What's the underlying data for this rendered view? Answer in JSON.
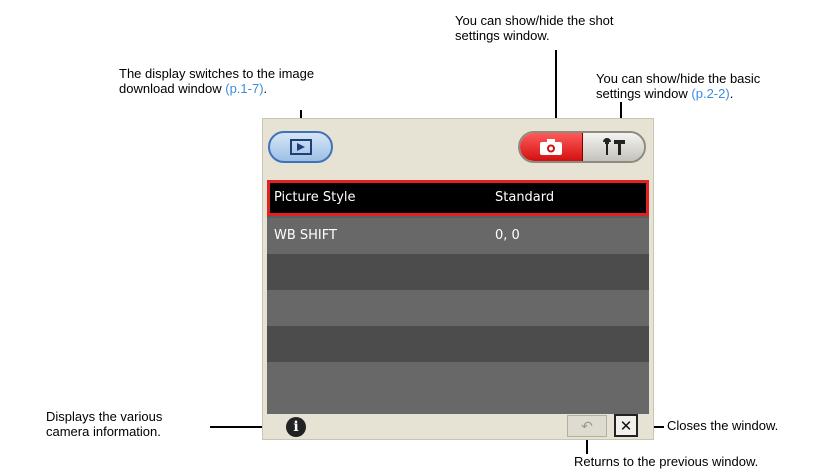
{
  "callouts": {
    "download": {
      "text": "The display switches to the image download window",
      "ref": "(p.1-7)",
      "end": "."
    },
    "shot": {
      "line1": "You can show/hide the shot",
      "line2": "settings window."
    },
    "basic": {
      "line1": "You can show/hide the basic",
      "line2": "settings window",
      "ref": "(p.2-2)",
      "end": "."
    },
    "info": {
      "line1": "Displays the various",
      "line2": "camera information."
    },
    "close": "Closes the window.",
    "back": "Returns to the previous window."
  },
  "window": {
    "rows": [
      {
        "label": "Picture Style",
        "value": "Standard",
        "selected": true
      },
      {
        "label": "WB SHIFT",
        "value": "0, 0"
      },
      {
        "label": "",
        "value": ""
      },
      {
        "label": "",
        "value": ""
      },
      {
        "label": "",
        "value": ""
      },
      {
        "label": "",
        "value": ""
      }
    ],
    "info_glyph": "i",
    "basic_glyph": "⚒",
    "close_glyph": "✕",
    "back_glyph": "↶"
  },
  "icons": {
    "download": "image-download-icon",
    "shot": "camera-icon",
    "basic": "tools-icon",
    "info": "info-icon",
    "back": "back-icon",
    "close": "close-icon"
  },
  "colors": {
    "accent_red": "#e02222",
    "link_blue": "#3a8ee0",
    "download_blue": "#3f73b8"
  }
}
